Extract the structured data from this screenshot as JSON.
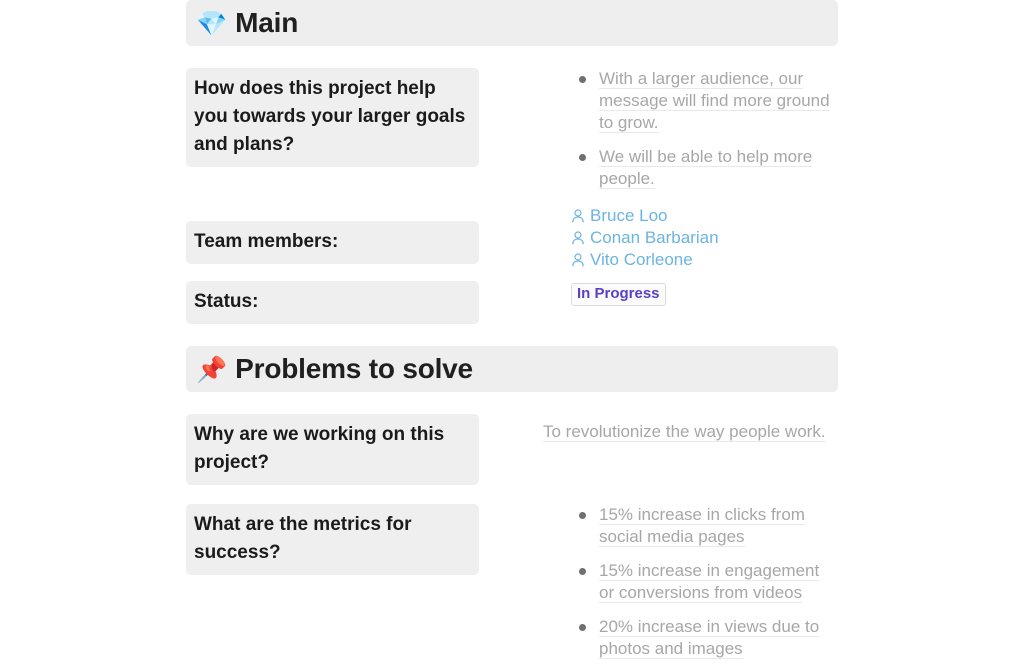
{
  "sections": [
    {
      "id": "main",
      "emoji": "💎",
      "emoji_name": "gem-stone-icon",
      "title": "Main",
      "rows": [
        {
          "question": "How does this project help you towards your larger goals and plans?",
          "answer_type": "bullets",
          "bullets": [
            "With a larger audience, our message will find more ground to grow.",
            "We will be able to help more people."
          ]
        },
        {
          "question": "Team members:",
          "answer_type": "members",
          "members": [
            "Bruce Loo",
            "Conan Barbarian",
            "Vito Corleone"
          ]
        },
        {
          "question": "Status:",
          "answer_type": "badge",
          "badge": "In Progress"
        }
      ]
    },
    {
      "id": "problems-to-solve",
      "emoji": "📌",
      "emoji_name": "pushpin-icon",
      "title": "Problems to solve",
      "rows": [
        {
          "question": "Why are we working on this project?",
          "answer_type": "text",
          "text": "To revolutionize the way people work."
        },
        {
          "question": "What are the metrics for success?",
          "answer_type": "bullets",
          "bullets": [
            "15% increase in clicks from social media pages",
            "15% increase in engagement or conversions from videos",
            "20% increase in views due to photos and images"
          ]
        }
      ]
    }
  ],
  "colors": {
    "band_gray": "#eeeeee",
    "block_gray": "#efefef",
    "answer_gray": "#a7a7a7",
    "member_blue": "#6cb4e0",
    "badge_purple": "#5b3fc4",
    "title_black": "#202020"
  }
}
